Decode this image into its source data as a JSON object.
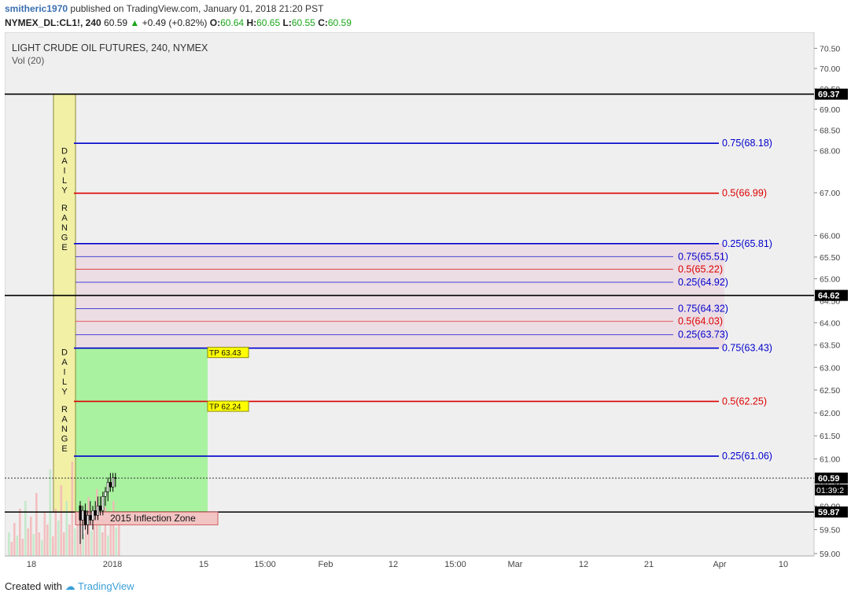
{
  "header": {
    "author": "smitheric1970",
    "published_text": "published on TradingView.com, January 01, 2018 21:20 PST",
    "symbol": "NYMEX_DL:CL1!, 240",
    "last": "60.59",
    "change": "+0.49 (+0.82%)",
    "o_label": "O:",
    "o": "60.64",
    "h_label": "H:",
    "h": "60.65",
    "l_label": "L:",
    "l": "60.55",
    "c_label": "C:",
    "c": "60.59"
  },
  "footer": {
    "created_with": "Created with",
    "brand": "TradingView"
  },
  "chart_data": {
    "type": "line",
    "title": "LIGHT CRUDE OIL FUTURES, 240, NYMEX",
    "subtitle": "Vol (20)",
    "y_scale": "log",
    "ylim": [
      58.95,
      70.9
    ],
    "y_ticks": [
      "59.00",
      "59.50",
      "60.00",
      "60.50",
      "61.00",
      "61.50",
      "62.00",
      "62.50",
      "63.00",
      "63.50",
      "64.00",
      "64.50",
      "65.00",
      "65.50",
      "66.00",
      "67.00",
      "68.00",
      "68.50",
      "69.00",
      "69.50",
      "70.00",
      "70.50"
    ],
    "x_ticks": [
      "18",
      "2018",
      "15",
      "15:00",
      "Feb",
      "12",
      "15:00",
      "Mar",
      "12",
      "21",
      "Apr",
      "10"
    ],
    "horizontal_levels": [
      {
        "label": "0.75(68.18)",
        "value": 68.18,
        "color": "#0000cc"
      },
      {
        "label": "0.5(66.99)",
        "value": 66.99,
        "color": "#dd0000"
      },
      {
        "label": "0.25(65.81)",
        "value": 65.81,
        "color": "#0000cc"
      },
      {
        "label": "0.75(63.43)",
        "value": 63.43,
        "color": "#0000cc"
      },
      {
        "label": "0.5(62.25)",
        "value": 62.25,
        "color": "#dd0000"
      },
      {
        "label": "0.25(61.06)",
        "value": 61.06,
        "color": "#0000cc"
      }
    ],
    "inner_levels": [
      {
        "label": "0.75(65.51)",
        "value": 65.51,
        "color": "#0000cc"
      },
      {
        "label": "0.5(65.22)",
        "value": 65.22,
        "color": "#dd0000"
      },
      {
        "label": "0.25(64.92)",
        "value": 64.92,
        "color": "#0000cc"
      },
      {
        "label": "0.75(64.32)",
        "value": 64.32,
        "color": "#0000cc"
      },
      {
        "label": "0.5(64.03)",
        "value": 64.03,
        "color": "#dd0000"
      },
      {
        "label": "0.25(63.73)",
        "value": 63.73,
        "color": "#0000cc"
      }
    ],
    "black_lines": [
      69.37,
      64.62,
      59.87
    ],
    "price_badges": [
      {
        "value": 69.37,
        "text": "69.37"
      },
      {
        "value": 64.62,
        "text": "64.62"
      },
      {
        "value": 60.59,
        "text": "60.59"
      },
      {
        "value": 59.87,
        "text": "59.87"
      }
    ],
    "countdown": "01:39:2",
    "daily_range_label": "DAILY RANGE",
    "tp_labels": [
      {
        "text": "TP 63.43",
        "value": 63.43
      },
      {
        "text": "TP 62.24",
        "value": 62.24
      }
    ],
    "zone_label": "2015 Inflection Zone",
    "zone_range": [
      59.87,
      59.6
    ],
    "pink_zone_range": [
      65.81,
      63.43
    ],
    "green_zone_range": [
      63.43,
      59.87
    ],
    "current_price": 60.59,
    "candles": [
      {
        "o": 60.0,
        "h": 60.1,
        "l": 59.2,
        "c": 59.7
      },
      {
        "o": 59.7,
        "h": 60.0,
        "l": 59.3,
        "c": 59.9
      },
      {
        "o": 59.9,
        "h": 60.05,
        "l": 59.5,
        "c": 59.6
      },
      {
        "o": 59.6,
        "h": 59.9,
        "l": 59.4,
        "c": 59.8
      },
      {
        "o": 59.8,
        "h": 60.1,
        "l": 59.6,
        "c": 59.7
      },
      {
        "o": 59.7,
        "h": 60.0,
        "l": 59.5,
        "c": 59.9
      },
      {
        "o": 59.9,
        "h": 60.1,
        "l": 59.7,
        "c": 59.8
      },
      {
        "o": 59.8,
        "h": 60.2,
        "l": 59.7,
        "c": 60.0
      },
      {
        "o": 60.0,
        "h": 60.2,
        "l": 59.8,
        "c": 59.9
      },
      {
        "o": 59.9,
        "h": 60.3,
        "l": 59.8,
        "c": 60.2
      },
      {
        "o": 60.2,
        "h": 60.4,
        "l": 60.0,
        "c": 60.3
      },
      {
        "o": 60.3,
        "h": 60.6,
        "l": 60.1,
        "c": 60.5
      },
      {
        "o": 60.5,
        "h": 60.7,
        "l": 60.3,
        "c": 60.4
      },
      {
        "o": 60.4,
        "h": 60.7,
        "l": 60.3,
        "c": 60.6
      },
      {
        "o": 60.6,
        "h": 60.7,
        "l": 60.4,
        "c": 60.59
      }
    ]
  }
}
